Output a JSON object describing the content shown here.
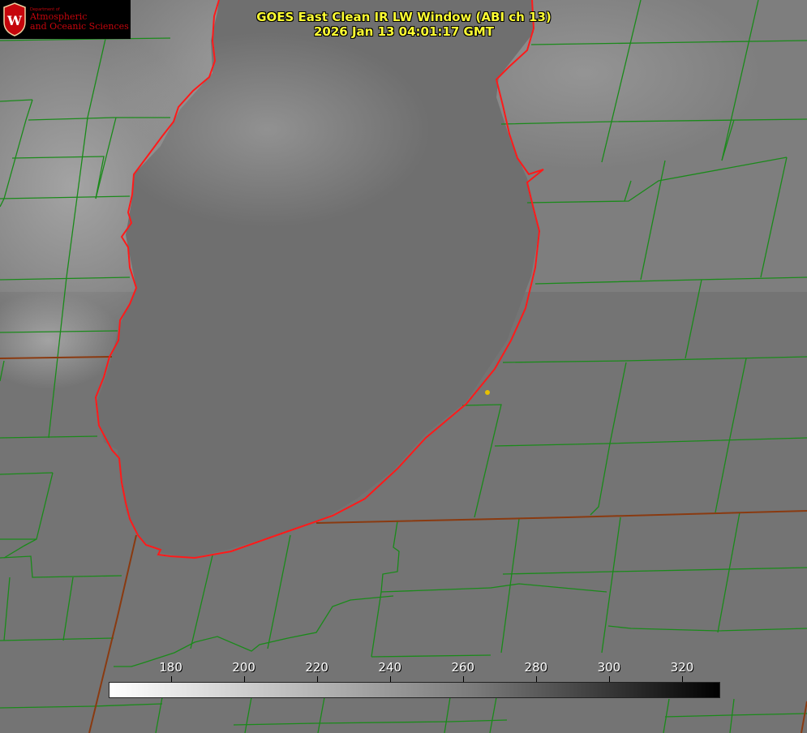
{
  "logo": {
    "department": "Department of",
    "line1": "Atmospheric",
    "line2": "and Oceanic Sciences",
    "seal_letter": "W",
    "seal_color": "#c5050c"
  },
  "title": {
    "line1": "GOES East Clean IR LW Window (ABI ch 13)",
    "line2": "2026 Jan 13 04:01:17 GMT"
  },
  "colorbar": {
    "ticks": [
      "180",
      "200",
      "220",
      "240",
      "260",
      "280",
      "300",
      "320"
    ],
    "range": [
      163,
      330
    ],
    "colors": {
      "low": "#ffffff",
      "mid": "#7a7a7a",
      "high": "#000000"
    }
  },
  "colors": {
    "county_lines": "#1a8a1a",
    "lake_outline": "#ff1a1a",
    "state_lines": "#8a3a10",
    "marker": "#e6c000",
    "title_text": "#ffff33"
  }
}
